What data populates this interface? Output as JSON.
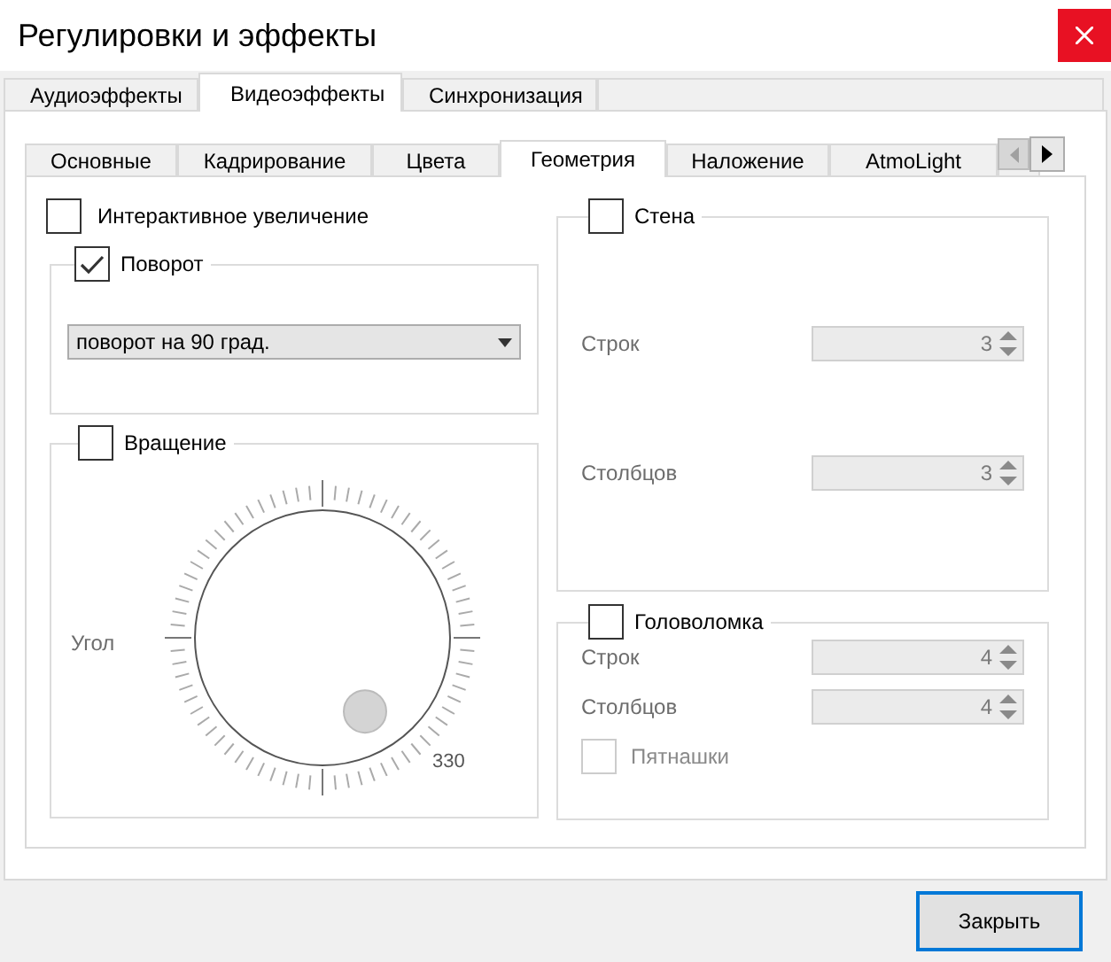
{
  "window": {
    "title": "Регулировки и эффекты"
  },
  "tabs": [
    {
      "label": "Аудиоэффекты",
      "selected": false
    },
    {
      "label": "Видеоэффекты",
      "selected": true
    },
    {
      "label": "Синхронизация",
      "selected": false
    }
  ],
  "subtabs": [
    {
      "label": "Основные",
      "selected": false
    },
    {
      "label": "Кадрирование",
      "selected": false
    },
    {
      "label": "Цвета",
      "selected": false
    },
    {
      "label": "Геометрия",
      "selected": true
    },
    {
      "label": "Наложение",
      "selected": false
    },
    {
      "label": "AtmoLight",
      "selected": false
    }
  ],
  "geometry": {
    "interactive_zoom": {
      "label": "Интерактивное увеличение",
      "checked": false
    },
    "rotate": {
      "label": "Поворот",
      "checked": true,
      "dropdown": "поворот на 90 град."
    },
    "rotation": {
      "label": "Вращение",
      "checked": false,
      "angle_label": "Угол",
      "reading": "330"
    },
    "wall": {
      "label": "Стена",
      "checked": false,
      "fields": [
        {
          "label": "Строк",
          "value": "3",
          "disabled": true
        },
        {
          "label": "Столбцов",
          "value": "3",
          "disabled": true
        }
      ]
    },
    "puzzle": {
      "label": "Головоломка",
      "checked": false,
      "fields": [
        {
          "label": "Строк",
          "value": "4",
          "disabled": true
        },
        {
          "label": "Столбцов",
          "value": "4",
          "disabled": true
        }
      ],
      "option": {
        "label": "Пятнашки",
        "checked": false,
        "disabled": true
      }
    }
  },
  "buttons": [
    "Закрыть"
  ]
}
